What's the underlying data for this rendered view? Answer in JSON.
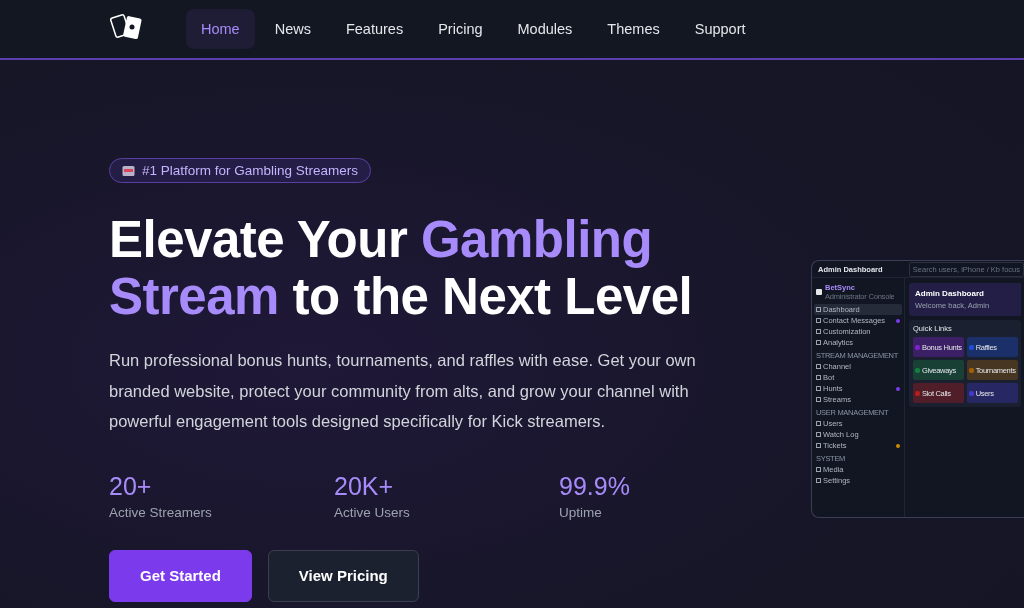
{
  "nav": {
    "items": [
      {
        "label": "Home",
        "selected": true
      },
      {
        "label": "News",
        "selected": false
      },
      {
        "label": "Features",
        "selected": false
      },
      {
        "label": "Pricing",
        "selected": false
      },
      {
        "label": "Modules",
        "selected": false
      },
      {
        "label": "Themes",
        "selected": false
      },
      {
        "label": "Support",
        "selected": false
      }
    ]
  },
  "hero": {
    "badge": "#1 Platform for Gambling Streamers",
    "headline": [
      {
        "text": "Elevate Your ",
        "accent": false
      },
      {
        "text": "Gambling",
        "accent": true
      },
      {
        "text": "Stream",
        "accent": true
      },
      {
        "text": " to the Next Level",
        "accent": false
      }
    ],
    "description": "Run professional bonus hunts, tournaments, and raffles with ease. Get your own branded website, protect your community from alts, and grow your channel with powerful engagement tools designed specifically for Kick streamers.",
    "stats": [
      {
        "value": "20+",
        "label": "Active Streamers"
      },
      {
        "value": "20K+",
        "label": "Active Users"
      },
      {
        "value": "99.9%",
        "label": "Uptime"
      }
    ],
    "buttons": [
      {
        "label": "Get Started",
        "kind": "primary"
      },
      {
        "label": "View Pricing",
        "kind": "secondary"
      }
    ]
  },
  "preview": {
    "title": "Admin Dashboard",
    "search": {
      "placeholder": "Search users, iPhone / Kb focus"
    },
    "brand": "BetSync",
    "brand_subtitle": "Administrator Console",
    "sidebar": [
      {
        "items": [
          {
            "label": "Dashboard",
            "selected": true
          },
          {
            "label": "Contact Messages",
            "selected": false,
            "color": "#7c3aed"
          },
          {
            "label": "Customization",
            "selected": false
          },
          {
            "label": "Analytics",
            "selected": false
          }
        ]
      },
      {
        "section": "STREAM MANAGEMENT",
        "items": [
          {
            "label": "Channel",
            "selected": false
          },
          {
            "label": "Bot",
            "selected": false
          },
          {
            "label": "Hunts",
            "selected": false,
            "color": "#7c3aed"
          },
          {
            "label": "Streams",
            "selected": false
          }
        ]
      },
      {
        "section": "USER MANAGEMENT",
        "items": [
          {
            "label": "Users",
            "selected": false
          },
          {
            "label": "Watch Log",
            "selected": false
          },
          {
            "label": "Tickets",
            "selected": false,
            "color": "#ca8a04"
          }
        ]
      },
      {
        "section": "SYSTEM",
        "items": [
          {
            "label": "Media",
            "selected": false
          },
          {
            "label": "Settings",
            "selected": false
          }
        ]
      }
    ],
    "heading": "Admin Dashboard",
    "welcome": "Welcome back, Admin",
    "quick_links_title": "Quick Links",
    "quick_links": [
      {
        "label": "Bonus Hunts",
        "color": "#7e22ce"
      },
      {
        "label": "Raffles",
        "color": "#1d4ed8"
      },
      {
        "label": "Giveaways",
        "color": "#15803d"
      },
      {
        "label": "Tournaments",
        "color": "#a16207"
      },
      {
        "label": "Slot Calls",
        "color": "#b91c1c"
      },
      {
        "label": "Users",
        "color": "#4338ca"
      }
    ]
  }
}
